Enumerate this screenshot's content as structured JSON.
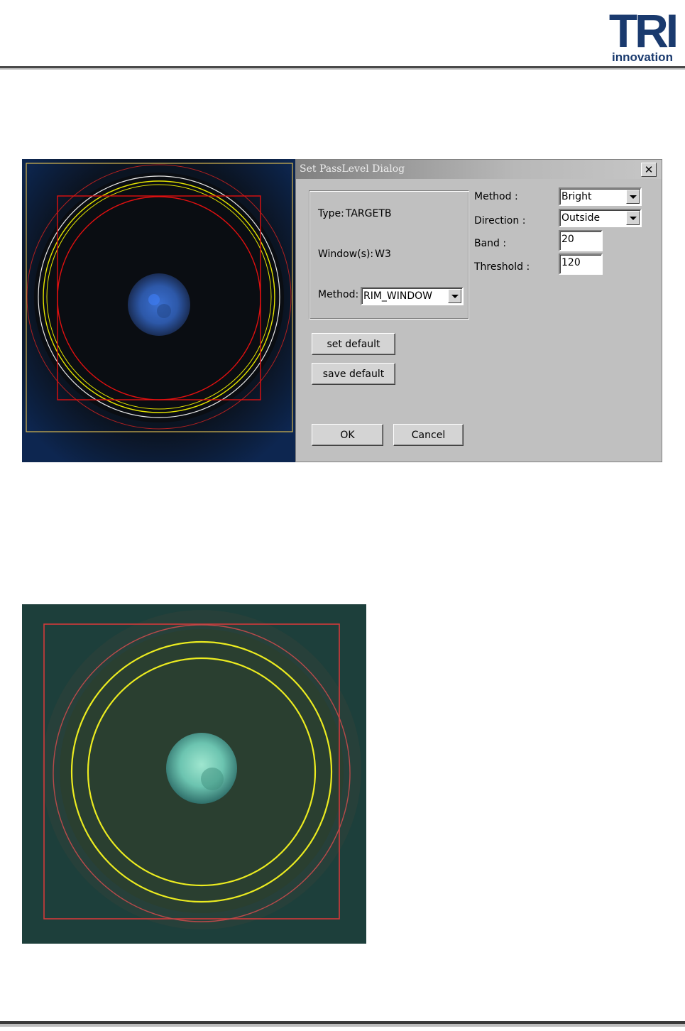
{
  "header": {
    "logo_wordmark": "TRI",
    "logo_tagline": "innovation"
  },
  "dialog": {
    "title": "Set PassLevel Dialog",
    "close_glyph": "✕",
    "type_label": "Type:",
    "type_value": "TARGETB",
    "window_label": "Window(s):",
    "window_value": "W3",
    "method_label": "Method:",
    "method_value": "RIM_WINDOW",
    "params": {
      "method_label": "Method :",
      "method_value": "Bright",
      "direction_label": "Direction :",
      "direction_value": "Outside",
      "band_label": "Band :",
      "band_value": "20",
      "threshold_label": "Threshold :",
      "threshold_value": "120"
    },
    "buttons": {
      "set_default": "set default",
      "save_default": "save default",
      "ok": "OK",
      "cancel": "Cancel"
    }
  },
  "colors": {
    "dialog_bg": "#c0c0c0",
    "overlay_red": "#e01010",
    "overlay_yellow": "#e6e600",
    "overlay_white": "#e8e8e8",
    "logo_blue": "#1a3a6e"
  },
  "icons": {
    "close": "close-icon",
    "dropdown": "chevron-down-icon"
  }
}
